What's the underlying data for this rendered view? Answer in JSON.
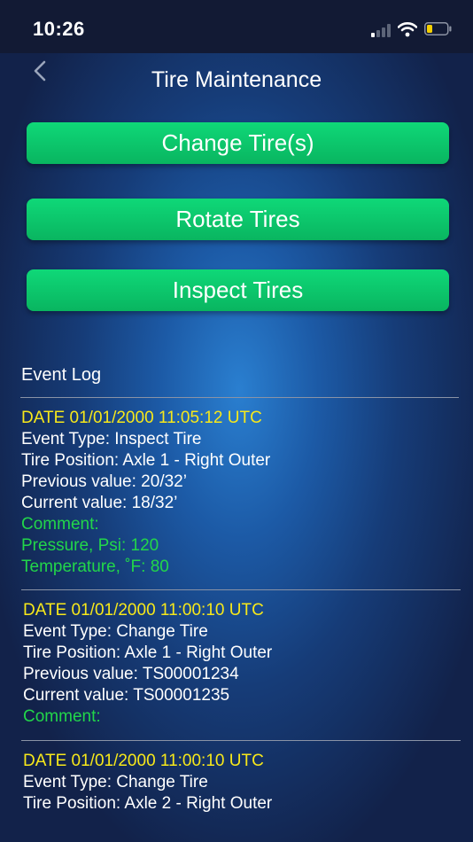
{
  "status_bar": {
    "time": "10:26",
    "colors": {
      "battery_level": "#f5d000"
    }
  },
  "header": {
    "title": "Tire Maintenance",
    "back_icon": "chevron-left-icon"
  },
  "actions": {
    "change_tires": "Change Tire(s)",
    "rotate_tires": "Rotate Tires",
    "inspect_tires": "Inspect Tires"
  },
  "event_log": {
    "heading": "Event Log",
    "entries": [
      {
        "date": "DATE 01/01/2000 11:05:12 UTC",
        "event_type": "Event Type: Inspect Tire",
        "tire_position": "Tire Position: Axle 1 - Right Outer",
        "previous_value": "Previous value: 20/32’",
        "current_value": "Current value: 18/32’",
        "comment": "Comment:",
        "pressure": "Pressure, Psi: 120",
        "temperature": "Temperature, ˚F: 80"
      },
      {
        "date": "DATE 01/01/2000 11:00:10 UTC",
        "event_type": "Event Type: Change Tire",
        "tire_position": "Tire Position: Axle 1 - Right Outer",
        "previous_value": "Previous value: TS00001234",
        "current_value": "Current value: TS00001235",
        "comment": "Comment:"
      },
      {
        "date": "DATE 01/01/2000 11:00:10 UTC",
        "event_type": "Event Type: Change Tire",
        "tire_position": "Tire Position: Axle 2 - Right Outer"
      }
    ]
  },
  "colors": {
    "button_green": "#0fd878",
    "date_yellow": "#f7e81a",
    "comment_green": "#22d64a",
    "status_bar_bg": "#121a34"
  }
}
